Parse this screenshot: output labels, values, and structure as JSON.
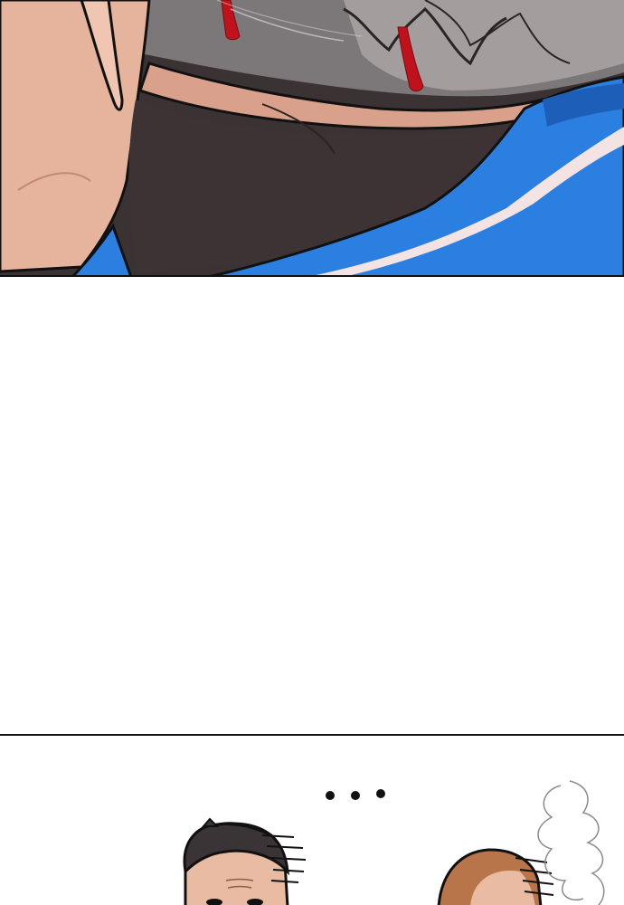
{
  "panels": {
    "top": {
      "description_label": ""
    },
    "bottom": {
      "speech": "• • •"
    }
  },
  "colors": {
    "skin": "#e9b8a0",
    "skin_shadow": "#d39a86",
    "shirt_blue": "#2a7fe0",
    "shirt_dark": "#1d5fb8",
    "stripe": "#f2dfe0",
    "hair_dark": "#3a3436",
    "blood": "#c0121c",
    "ink": "#111111",
    "hair_brown": "#b9754a"
  }
}
